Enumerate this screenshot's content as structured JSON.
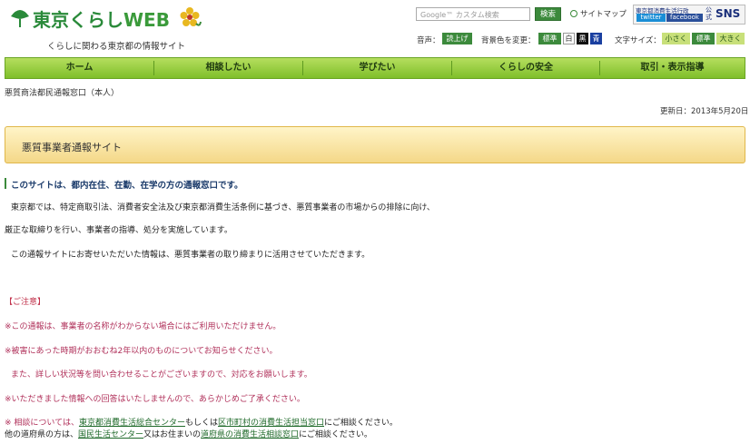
{
  "header": {
    "logo_text_main": "東京くらし",
    "logo_text_web": "WEB",
    "tagline": "くらしに関わる東京都の情報サイト",
    "search_placeholder": "Google™ カスタム検索",
    "search_button": "検索",
    "sitemap_label": "サイトマップ",
    "sns_small_text": "東京都消費生活行政",
    "sns_twitter": "twitter",
    "sns_facebook": "facebook",
    "sns_kokai": "公式",
    "sns_label": "SNS",
    "voice_label": "音声：",
    "voice_button": "読上げ",
    "bg_label": "背景色を変更：",
    "bg_options": [
      "標準",
      "白",
      "黒",
      "青"
    ],
    "font_label": "文字サイズ：",
    "font_options": [
      "小さく",
      "標準",
      "大きく"
    ]
  },
  "nav": {
    "items": [
      "ホーム",
      "相談したい",
      "学びたい",
      "くらしの安全",
      "取引・表示指導"
    ]
  },
  "breadcrumb": "悪質商法都民通報窓口（本人）",
  "updated": "更新日：2013年5月20日",
  "title": "悪質事業者通報サイト",
  "lead": "このサイトは、都内在住、在勤、在学の方の通報窓口です。",
  "paragraphs": [
    "東京都では、特定商取引法、消費者安全法及び東京都消費生活条例に基づき、悪質事業者の市場からの排除に向け、",
    "厳正な取締りを行い、事業者の指導、処分を実施しています。",
    "この通報サイトにお寄せいただいた情報は、悪質事業者の取り締まりに活用させていただきます。"
  ],
  "notice": {
    "heading": "【ご注意】",
    "items": [
      "※この通報は、事業者の名称がわからない場合にはご利用いただけません。",
      "※被害にあった時期がおおむね2年以内のものについてお知らせください。",
      "また、詳しい状況等を問い合わせることがございますので、対応をお願いします。",
      "※いただきました情報への回答はいたしませんので、あらかじめご了承ください。"
    ],
    "consult1_prefix": "※ 相談については、",
    "consult1_link1": "東京都消費生活総合センター",
    "consult1_mid": "もしくは",
    "consult1_link2": "区市町村の消費生活担当窓口",
    "consult1_suffix": "にご相談ください。",
    "consult2_prefix": "他の道府県の方は、",
    "consult2_link1": "国民生活センター",
    "consult2_mid": "又はお住まいの",
    "consult2_link2": "道府県の消費生活相談窓口",
    "consult2_suffix": "にご相談ください。"
  },
  "colors": {
    "accent_green": "#3c8a3c",
    "nav_green": "#8fcf3a",
    "title_band": "#f4d888",
    "notice_red": "#b0305a"
  }
}
